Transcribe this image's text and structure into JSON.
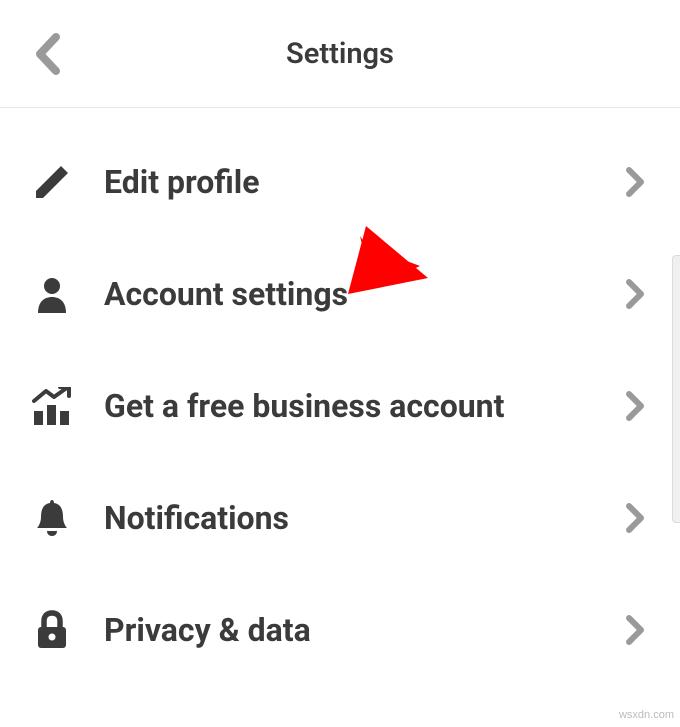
{
  "header": {
    "title": "Settings"
  },
  "menu": {
    "items": [
      {
        "icon": "pencil-icon",
        "label": "Edit profile"
      },
      {
        "icon": "person-icon",
        "label": "Account settings"
      },
      {
        "icon": "chart-icon",
        "label": "Get a free business account"
      },
      {
        "icon": "bell-icon",
        "label": "Notifications"
      },
      {
        "icon": "lock-icon",
        "label": "Privacy & data"
      }
    ]
  },
  "watermark": "wsxdn.com",
  "colors": {
    "text": "#3b3b3b",
    "chevron": "#9a9a9a",
    "arrow": "#ff0000"
  }
}
